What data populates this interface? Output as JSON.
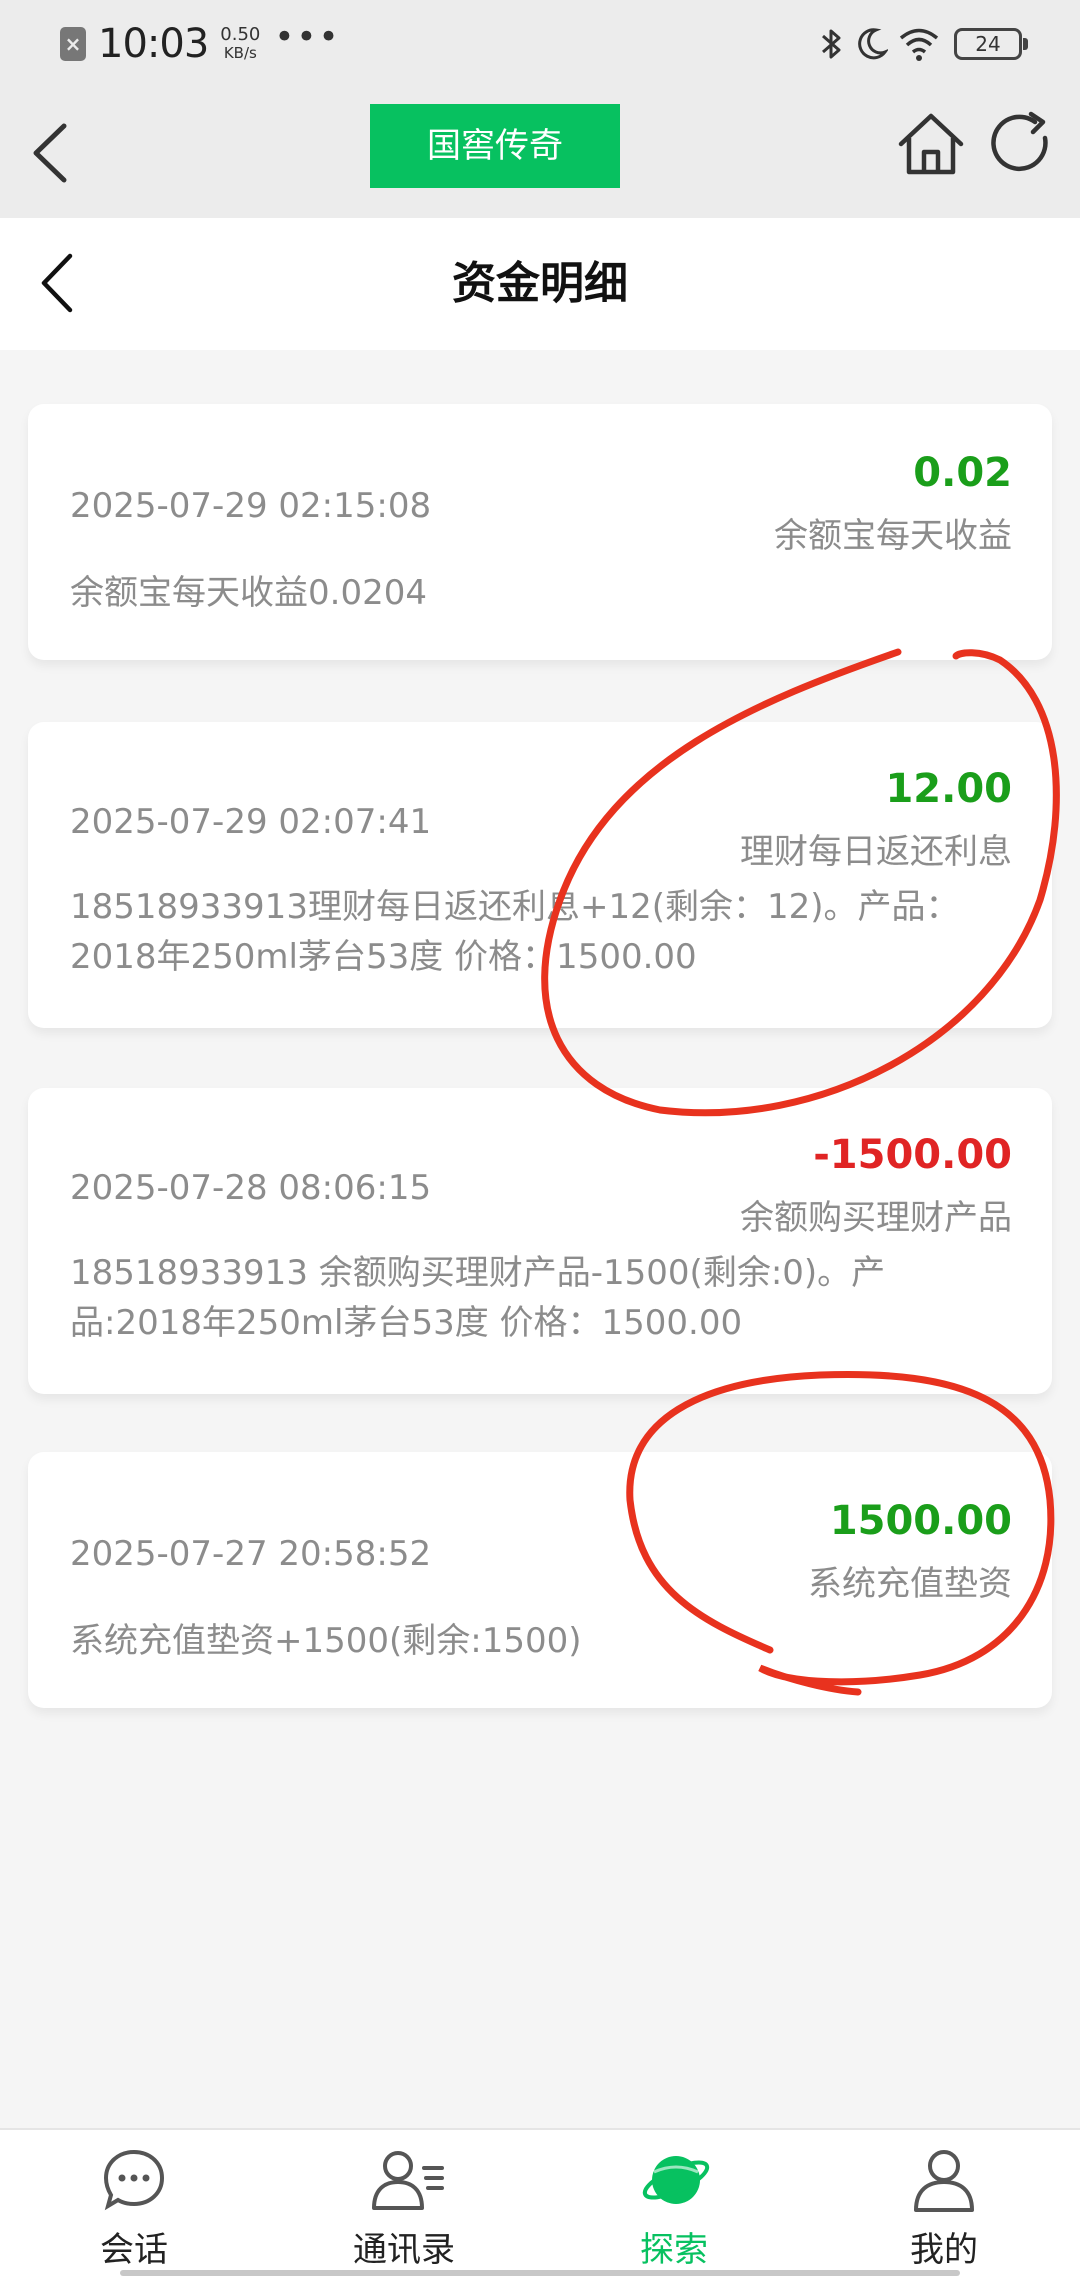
{
  "status_bar": {
    "time": "10:03",
    "speed_value": "0.50",
    "speed_unit": "KB/s",
    "battery": "24"
  },
  "app_header": {
    "title": "国窖传奇"
  },
  "page": {
    "title": "资金明细"
  },
  "records": [
    {
      "time": "2025-07-29 02:15:08",
      "amount": "0.02",
      "type": "余额宝每天收益",
      "description": "余额宝每天收益0.0204",
      "sign": "positive"
    },
    {
      "time": "2025-07-29 02:07:41",
      "amount": "12.00",
      "type": "理财每日返还利息",
      "description": "18518933913理财每日返还利息+12(剩余：12)。产品：2018年250ml茅台53度 价格：1500.00",
      "sign": "positive"
    },
    {
      "time": "2025-07-28 08:06:15",
      "amount": "-1500.00",
      "type": "余额购买理财产品",
      "description": "18518933913 余额购买理财产品-1500(剩余:0)。产品:2018年250ml茅台53度 价格：1500.00",
      "sign": "negative"
    },
    {
      "time": "2025-07-27 20:58:52",
      "amount": "1500.00",
      "type": "系统充值垫资",
      "description": "系统充值垫资+1500(剩余:1500)",
      "sign": "positive"
    }
  ],
  "tabs": [
    {
      "label": "会话",
      "icon": "chat-bubble-icon"
    },
    {
      "label": "通讯录",
      "icon": "contacts-icon"
    },
    {
      "label": "探索",
      "icon": "planet-icon",
      "active": true
    },
    {
      "label": "我的",
      "icon": "person-icon"
    }
  ],
  "colors": {
    "accent": "#07c160",
    "positive_amount": "#1a9e1a",
    "negative_amount": "#e02424",
    "annotation": "#e8321e"
  }
}
